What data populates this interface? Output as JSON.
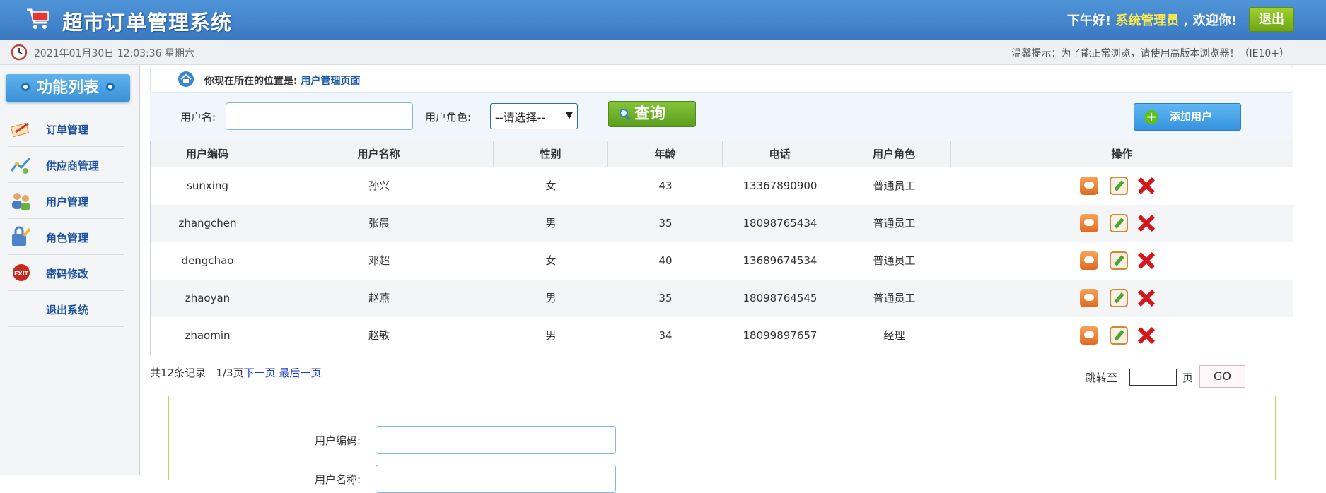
{
  "header": {
    "title": "超市订单管理系统",
    "greeting_prefix": "下午好!",
    "username": "系统管理员",
    "greeting_suffix": ", 欢迎你!",
    "logout_label": "退出",
    "cart_icon": "shopping-cart-icon"
  },
  "infobar": {
    "datetime": "2021年01月30日 12:03:36 星期六",
    "tip": "温馨提示：为了能正常浏览，请使用高版本浏览器！（IE10+）"
  },
  "sidebar": {
    "title": "功能列表",
    "items": [
      {
        "label": "订单管理",
        "icon": "order-icon"
      },
      {
        "label": "供应商管理",
        "icon": "supplier-icon"
      },
      {
        "label": "用户管理",
        "icon": "users-icon"
      },
      {
        "label": "角色管理",
        "icon": "role-icon"
      },
      {
        "label": "密码修改",
        "icon": "exit-icon"
      },
      {
        "label": "退出系统",
        "icon": ""
      }
    ]
  },
  "location": {
    "prefix": "你现在所在的位置是:",
    "page": "用户管理页面"
  },
  "search": {
    "username_label": "用户名:",
    "username_value": "",
    "role_label": "用户角色:",
    "role_selected": "--请选择--",
    "query_label": "查询",
    "add_user_label": "添加用户"
  },
  "table": {
    "headers": [
      "用户编码",
      "用户名称",
      "性别",
      "年龄",
      "电话",
      "用户角色",
      "操作"
    ],
    "rows": [
      [
        "sunxing",
        "孙兴",
        "女",
        "43",
        "13367890900",
        "普通员工"
      ],
      [
        "zhangchen",
        "张晨",
        "男",
        "35",
        "18098765434",
        "普通员工"
      ],
      [
        "dengchao",
        "邓超",
        "女",
        "40",
        "13689674534",
        "普通员工"
      ],
      [
        "zhaoyan",
        "赵燕",
        "男",
        "35",
        "18098764545",
        "普通员工"
      ],
      [
        "zhaomin",
        "赵敏",
        "男",
        "34",
        "18099897657",
        "经理"
      ]
    ]
  },
  "pagination": {
    "total": "共12条记录",
    "pages": "1/3页",
    "next": "下一页",
    "last": "最后一页",
    "jump_label": "跳转至",
    "page_unit": "页",
    "go_label": "GO"
  },
  "form": {
    "code_label": "用户编码:",
    "name_label": "用户名称:"
  },
  "colors": {
    "header_bg": "#3a78c2",
    "username_color": "#ffe84d",
    "logout_green": "#6fa516",
    "query_green": "#5a9e1c",
    "add_blue": "#3693df",
    "link_blue": "#1a3fc4"
  }
}
